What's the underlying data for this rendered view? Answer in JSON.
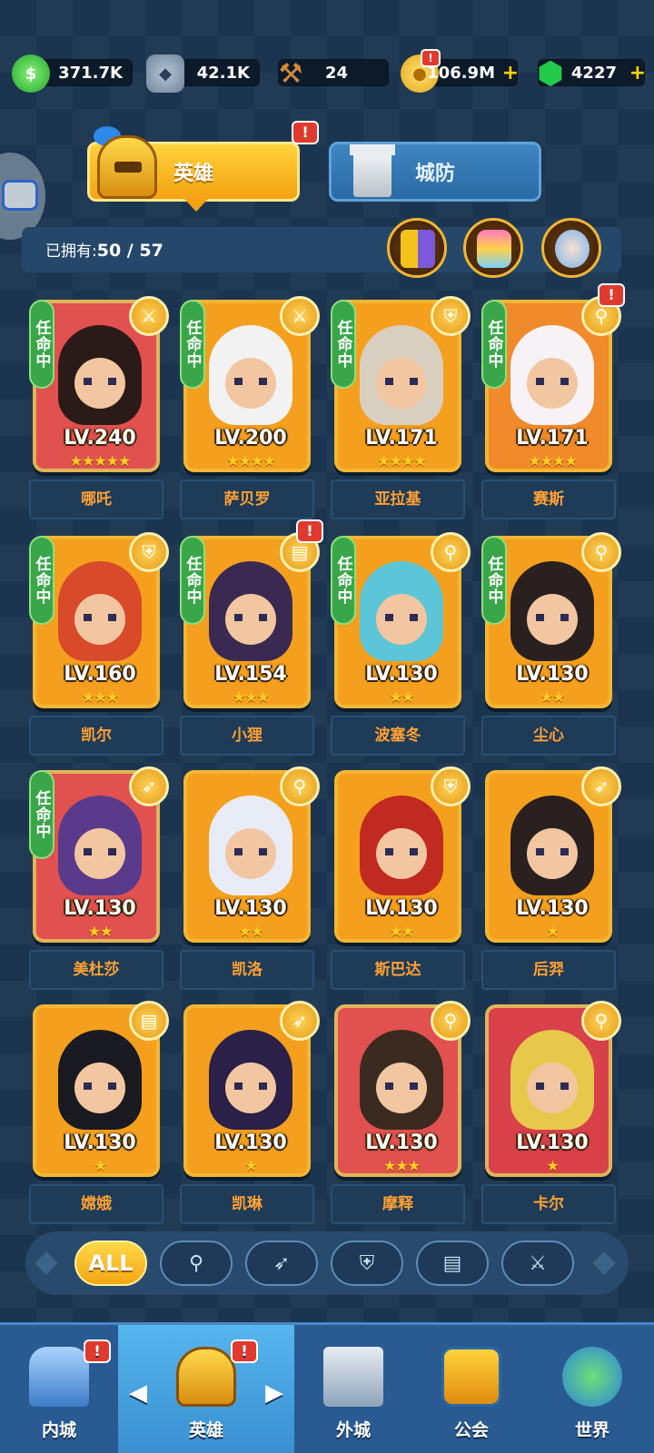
{
  "resources": [
    {
      "name": "gem-cash",
      "value": "371.7K",
      "color": "#3cd03c"
    },
    {
      "name": "stone",
      "value": "42.1K",
      "color": "#8da0b6"
    },
    {
      "name": "hammer",
      "value": "24",
      "color": "#d28a3a"
    },
    {
      "name": "gold",
      "value": "106.9M",
      "color": "#f2c21a"
    },
    {
      "name": "emerald",
      "value": "4227",
      "color": "#20c84a"
    }
  ],
  "tabs": {
    "hero": "英雄",
    "defense": "城防"
  },
  "owned": {
    "label": "已拥有:",
    "count": "50 / 57"
  },
  "assign_label": "任命中",
  "heroes": [
    {
      "name": "哪吒",
      "level": "LV.240",
      "stars": "★★★★★",
      "role": "warrior",
      "assigned": true
    },
    {
      "name": "萨贝罗",
      "level": "LV.200",
      "stars": "★★★★",
      "role": "warrior",
      "assigned": true
    },
    {
      "name": "亚拉基",
      "level": "LV.171",
      "stars": "★★★★",
      "role": "defense",
      "assigned": true
    },
    {
      "name": "赛斯",
      "level": "LV.171",
      "stars": "★★★★",
      "role": "mage",
      "assigned": true
    },
    {
      "name": "凯尔",
      "level": "LV.160",
      "stars": "★★★",
      "role": "defense",
      "assigned": true
    },
    {
      "name": "小狸",
      "level": "LV.154",
      "stars": "★★★",
      "role": "book",
      "assigned": true
    },
    {
      "name": "波塞冬",
      "level": "LV.130",
      "stars": "★★",
      "role": "mage",
      "assigned": true
    },
    {
      "name": "尘心",
      "level": "LV.130",
      "stars": "★★",
      "role": "mage",
      "assigned": true
    },
    {
      "name": "美杜莎",
      "level": "LV.130",
      "stars": "★★",
      "role": "archer",
      "assigned": true
    },
    {
      "name": "凯洛",
      "level": "LV.130",
      "stars": "★★",
      "role": "mage",
      "assigned": false
    },
    {
      "name": "斯巴达",
      "level": "LV.130",
      "stars": "★★",
      "role": "defense",
      "assigned": false
    },
    {
      "name": "后羿",
      "level": "LV.130",
      "stars": "★",
      "role": "archer",
      "assigned": false
    },
    {
      "name": "嫦娥",
      "level": "LV.130",
      "stars": "★",
      "role": "book",
      "assigned": false
    },
    {
      "name": "凯琳",
      "level": "LV.130",
      "stars": "★",
      "role": "archer",
      "assigned": false
    },
    {
      "name": "摩释",
      "level": "LV.130",
      "stars": "★★★",
      "role": "mage",
      "assigned": false
    },
    {
      "name": "卡尔",
      "level": "LV.130",
      "stars": "★",
      "role": "mage",
      "assigned": false
    }
  ],
  "filter": {
    "all": "ALL",
    "options": [
      "mage",
      "archer",
      "defense",
      "book",
      "warrior"
    ]
  },
  "nav": [
    {
      "label": "内城"
    },
    {
      "label": "英雄"
    },
    {
      "label": "外城"
    },
    {
      "label": "公会"
    },
    {
      "label": "世界"
    }
  ],
  "badge_mark": "!"
}
